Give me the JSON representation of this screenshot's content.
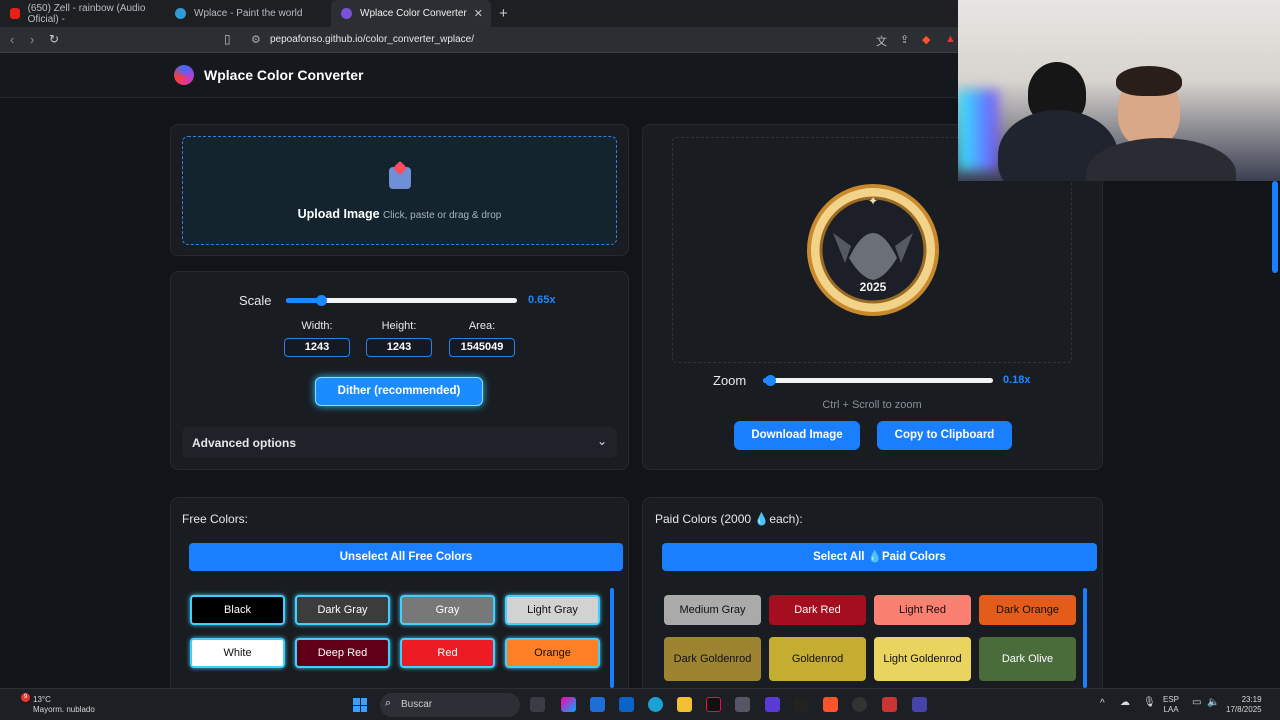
{
  "browser": {
    "tabs": [
      {
        "title": "(650) Zell - rainbow (Audio Oficial) -",
        "fav_color": "#e62117"
      },
      {
        "title": "Wplace - Paint the world",
        "fav_color": "#2f9ad6"
      },
      {
        "title": "Wplace Color Converter",
        "fav_color": "#7a52d6"
      }
    ],
    "url": "pepoafonso.github.io/color_converter_wplace/"
  },
  "header": {
    "title": "Wplace Color Converter"
  },
  "upload": {
    "title": "Upload Image",
    "hint": "Click, paste or drag & drop"
  },
  "scale": {
    "label": "Scale",
    "value_label": "0.65x",
    "fraction": 0.15
  },
  "dimensions": {
    "width_label": "Width:",
    "width_value": "1243",
    "height_label": "Height:",
    "height_value": "1243",
    "area_label": "Area:",
    "area_value": "1545049"
  },
  "dither_label": "Dither (recommended)",
  "advanced_label": "Advanced options",
  "preview": {
    "badge_year": "2025"
  },
  "zoom": {
    "label": "Zoom",
    "value_label": "0.18x",
    "fraction": 0.03,
    "hint": "Ctrl + Scroll to zoom"
  },
  "actions": {
    "download": "Download Image",
    "copy": "Copy to Clipboard"
  },
  "free": {
    "title": "Free Colors:",
    "toggle_label": "Unselect All Free Colors",
    "colors": [
      {
        "name": "Black",
        "bg": "#000000",
        "fg": "#ffffff"
      },
      {
        "name": "Dark Gray",
        "bg": "#3c3c3c",
        "fg": "#ffffff"
      },
      {
        "name": "Gray",
        "bg": "#787878",
        "fg": "#ffffff"
      },
      {
        "name": "Light Gray",
        "bg": "#d2d2d2",
        "fg": "#111111"
      },
      {
        "name": "White",
        "bg": "#ffffff",
        "fg": "#111111"
      },
      {
        "name": "Deep Red",
        "bg": "#600018",
        "fg": "#ffffff"
      },
      {
        "name": "Red",
        "bg": "#ed1c24",
        "fg": "#ffffff"
      },
      {
        "name": "Orange",
        "bg": "#ff7f27",
        "fg": "#111111"
      }
    ]
  },
  "paid": {
    "title": "Paid Colors (2000 💧each):",
    "toggle_label": "Select All 💧Paid Colors",
    "colors": [
      {
        "name": "Medium Gray",
        "bg": "#aaaaaa",
        "fg": "#111111"
      },
      {
        "name": "Dark Red",
        "bg": "#a50e1e",
        "fg": "#ffffff"
      },
      {
        "name": "Light Red",
        "bg": "#fa8072",
        "fg": "#111111"
      },
      {
        "name": "Dark Orange",
        "bg": "#e45c1a",
        "fg": "#111111"
      },
      {
        "name": "Dark Goldenrod",
        "bg": "#9c8431",
        "fg": "#111111"
      },
      {
        "name": "Goldenrod",
        "bg": "#c5ad31",
        "fg": "#111111"
      },
      {
        "name": "Light Goldenrod",
        "bg": "#e8d45f",
        "fg": "#111111"
      },
      {
        "name": "Dark Olive",
        "bg": "#4a6b3a",
        "fg": "#ffffff"
      }
    ]
  },
  "taskbar": {
    "temperature": "13°C",
    "weather": "Mayorm. nublado",
    "badge": "9",
    "search": "Buscar",
    "lang_1": "ESP",
    "lang_2": "LAA",
    "time": "23:19",
    "date": "17/8/2025"
  }
}
